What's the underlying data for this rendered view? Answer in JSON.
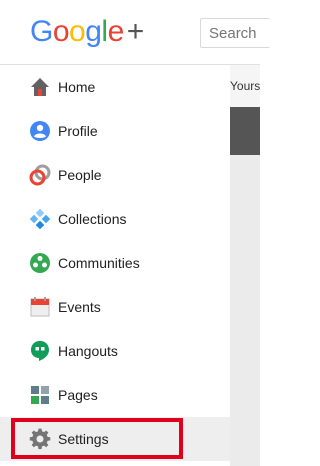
{
  "logo": {
    "letters": [
      "G",
      "o",
      "o",
      "g",
      "l",
      "e"
    ],
    "plus": "+",
    "colors": [
      "#4285f4",
      "#ea4335",
      "#fbbc05",
      "#4285f4",
      "#34a853",
      "#ea4335"
    ]
  },
  "search": {
    "placeholder": "Search"
  },
  "content": {
    "tab_label": "Yours"
  },
  "nav": {
    "items": [
      {
        "label": "Home",
        "icon": "home-icon"
      },
      {
        "label": "Profile",
        "icon": "profile-icon"
      },
      {
        "label": "People",
        "icon": "people-icon"
      },
      {
        "label": "Collections",
        "icon": "collections-icon"
      },
      {
        "label": "Communities",
        "icon": "communities-icon"
      },
      {
        "label": "Events",
        "icon": "events-icon"
      },
      {
        "label": "Hangouts",
        "icon": "hangouts-icon"
      },
      {
        "label": "Pages",
        "icon": "pages-icon"
      },
      {
        "label": "Settings",
        "icon": "gear-icon",
        "highlighted": true
      }
    ]
  },
  "colors": {
    "highlight_border": "#e0001b"
  }
}
